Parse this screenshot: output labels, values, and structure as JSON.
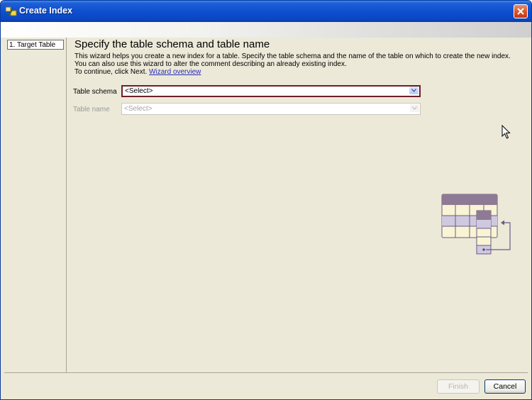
{
  "window": {
    "title": "Create Index",
    "close_icon": "close-icon",
    "app_icon": "create-index-icon"
  },
  "steps": [
    {
      "label": "1. Target Table",
      "selected": true
    }
  ],
  "content": {
    "heading": "Specify the table schema and table name",
    "description_lines": [
      "This wizard helps you create a new index for a table. Specify the table schema and the name of the table on which to create the new index.",
      "You can also use this wizard to alter the comment describing an already existing index.",
      "To continue, click Next."
    ],
    "wizard_link": "Wizard overview",
    "table_schema": {
      "label": "Table schema",
      "value": "<Select>",
      "enabled": true
    },
    "table_name": {
      "label": "Table name",
      "value": "<Select>",
      "enabled": false
    },
    "illustration_icon": "table-index-illustration"
  },
  "footer": {
    "finish_label": "Finish",
    "finish_enabled": false,
    "cancel_label": "Cancel"
  },
  "colors": {
    "titlebar": "#0d4fd0",
    "window_bg": "#ece9d8",
    "link": "#2a2ab8",
    "active_border": "#6d1e2a"
  }
}
